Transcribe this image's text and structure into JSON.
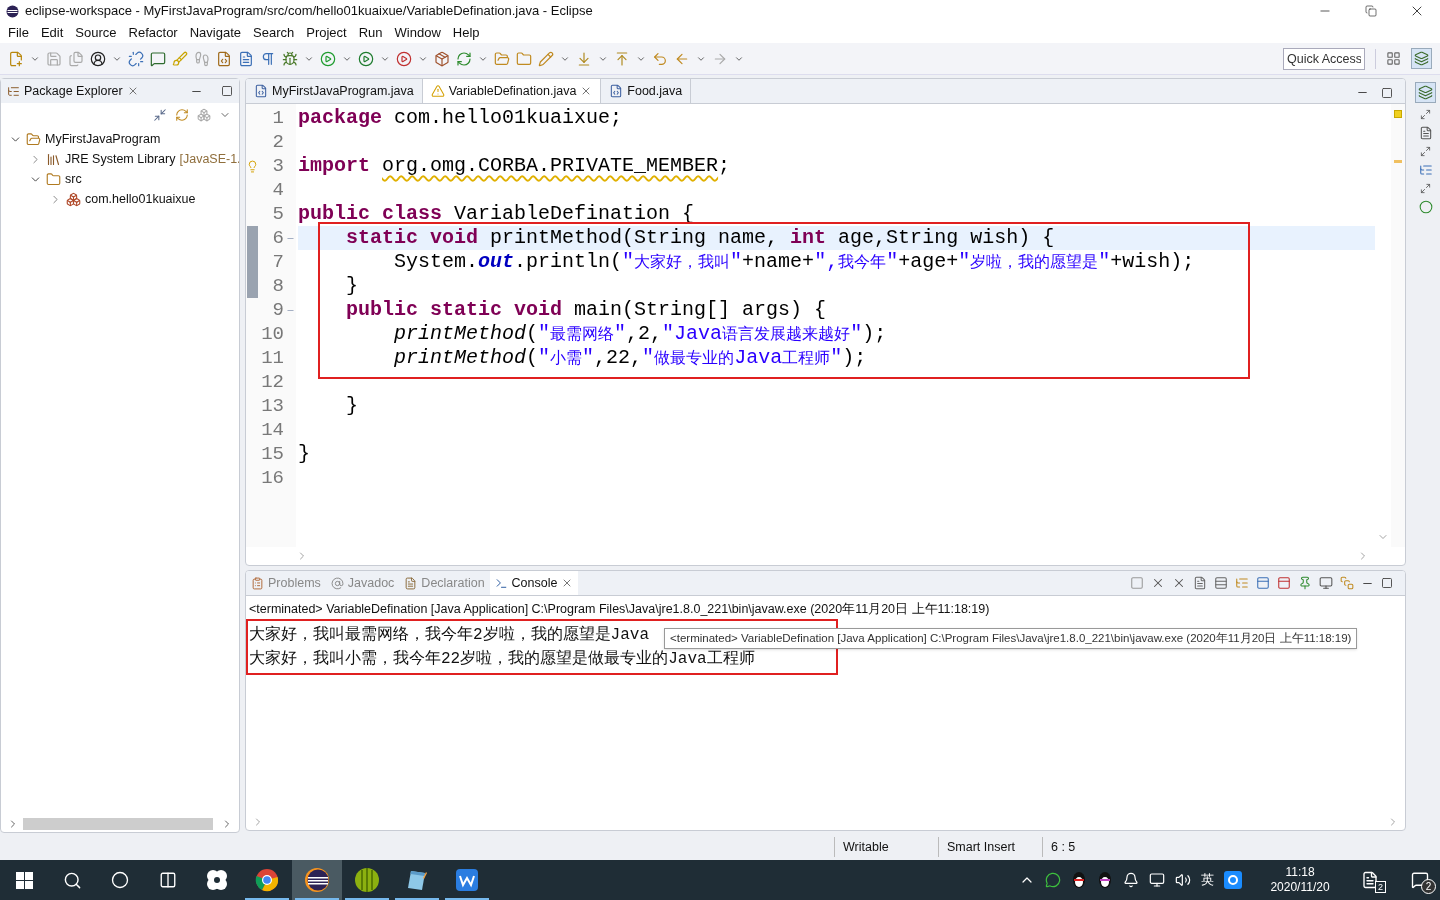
{
  "window": {
    "title": "eclipse-workspace - MyFirstJavaProgram/src/com/hello01kuaixue/VariableDefination.java - Eclipse"
  },
  "menu": [
    "File",
    "Edit",
    "Source",
    "Refactor",
    "Navigate",
    "Search",
    "Project",
    "Run",
    "Window",
    "Help"
  ],
  "toolbar": {
    "quick_access": {
      "placeholder": "Quick Access"
    }
  },
  "package_explorer": {
    "title": "Package Explorer",
    "tree": [
      {
        "label": "MyFirstJavaProgram",
        "kind": "project",
        "expanded": true,
        "children": [
          {
            "label": "JRE System Library",
            "suffix": "[JavaSE-1.",
            "kind": "library",
            "expanded": false
          },
          {
            "label": "src",
            "kind": "folder",
            "expanded": true,
            "children": [
              {
                "label": "com.hello01kuaixue",
                "kind": "package",
                "expanded": false
              }
            ]
          }
        ]
      }
    ]
  },
  "editor": {
    "tabs": [
      {
        "label": "MyFirstJavaProgram.java",
        "selected": false,
        "warning": false
      },
      {
        "label": "VariableDefination.java",
        "selected": true,
        "warning": true
      },
      {
        "label": "Food.java",
        "selected": false,
        "warning": false
      }
    ],
    "lines": [
      {
        "number": "1",
        "tokens": [
          {
            "kind": "keyword",
            "text": "package"
          },
          {
            "kind": "plain",
            "text": " com.hello01kuaixue;"
          }
        ]
      },
      {
        "number": "2"
      },
      {
        "number": "3",
        "warning": true,
        "tokens": [
          {
            "kind": "keyword",
            "text": "import "
          },
          {
            "kind": "warn",
            "text": "org.omg.CORBA.PRIVATE_MEMBER"
          },
          {
            "kind": "plain",
            "text": ";"
          }
        ]
      },
      {
        "number": "4"
      },
      {
        "number": "5",
        "tokens": [
          {
            "kind": "keyword",
            "text": "public class"
          },
          {
            "kind": "plain",
            "text": " VariableDefination {"
          }
        ]
      },
      {
        "number": "6",
        "fold": true,
        "current": true,
        "marked": true,
        "boxed": true,
        "tokens": [
          {
            "kind": "keyword",
            "text": "    static void"
          },
          {
            "kind": "plain",
            "text": " printMethod(String name, "
          },
          {
            "kind": "keyword",
            "text": "int"
          },
          {
            "kind": "plain",
            "text": " age,String wish) {"
          }
        ]
      },
      {
        "number": "7",
        "marked": true,
        "boxed": true,
        "tokens": [
          {
            "kind": "plain",
            "text": "        System."
          },
          {
            "kind": "field",
            "text": "out"
          },
          {
            "kind": "plain",
            "text": ".println("
          },
          {
            "kind": "string",
            "text": "\"大家好，我叫\""
          },
          {
            "kind": "plain",
            "text": "+name+"
          },
          {
            "kind": "string",
            "text": "\",我今年\""
          },
          {
            "kind": "plain",
            "text": "+age+"
          },
          {
            "kind": "string",
            "text": "\"岁啦，我的愿望是\""
          },
          {
            "kind": "plain",
            "text": "+wish);"
          }
        ]
      },
      {
        "number": "8",
        "marked": true,
        "boxed": true,
        "tokens": [
          {
            "kind": "plain",
            "text": "    }"
          }
        ]
      },
      {
        "number": "9",
        "fold": true,
        "boxed": true,
        "tokens": [
          {
            "kind": "keyword",
            "text": "    public static void"
          },
          {
            "kind": "plain",
            "text": " main(String[] args) {"
          }
        ]
      },
      {
        "number": "10",
        "boxed": true,
        "tokens": [
          {
            "kind": "call",
            "text": "        printMethod"
          },
          {
            "kind": "plain",
            "text": "("
          },
          {
            "kind": "string",
            "text": "\"最需网络\""
          },
          {
            "kind": "plain",
            "text": ",2,"
          },
          {
            "kind": "string",
            "text": "\"Java语言发展越来越好\""
          },
          {
            "kind": "plain",
            "text": ");"
          }
        ]
      },
      {
        "number": "11",
        "boxed": true,
        "tokens": [
          {
            "kind": "call",
            "text": "        printMethod"
          },
          {
            "kind": "plain",
            "text": "("
          },
          {
            "kind": "string",
            "text": "\"小需\""
          },
          {
            "kind": "plain",
            "text": ",22,"
          },
          {
            "kind": "string",
            "text": "\"做最专业的Java工程师\""
          },
          {
            "kind": "plain",
            "text": ");"
          }
        ]
      },
      {
        "number": "12"
      },
      {
        "number": "13",
        "tokens": [
          {
            "kind": "plain",
            "text": "    }"
          }
        ]
      },
      {
        "number": "14"
      },
      {
        "number": "15",
        "tokens": [
          {
            "kind": "plain",
            "text": "}"
          }
        ]
      },
      {
        "number": "16"
      }
    ]
  },
  "console": {
    "tabs": [
      {
        "label": "Problems",
        "selected": false
      },
      {
        "label": "Javadoc",
        "selected": false
      },
      {
        "label": "Declaration",
        "selected": false
      },
      {
        "label": "Console",
        "selected": true
      }
    ],
    "header": "<terminated> VariableDefination [Java Application] C:\\Program Files\\Java\\jre1.8.0_221\\bin\\javaw.exe (2020年11月20日 上午11:18:19)",
    "boxed": true,
    "output": [
      "大家好，我叫最需网络，我今年2岁啦，我的愿望是Java",
      "大家好，我叫小需，我今年22岁啦，我的愿望是做最专业的Java工程师"
    ],
    "tooltip": "<terminated> VariableDefination [Java Application] C:\\Program Files\\Java\\jre1.8.0_221\\bin\\javaw.exe (2020年11月20日 上午11:18:19)"
  },
  "status_bar": [
    "Writable",
    "Smart Insert",
    "6 : 5"
  ],
  "taskbar": {
    "apps": [
      {
        "kind": "pinwheel",
        "running": false,
        "selected": false
      },
      {
        "kind": "chrome",
        "running": true,
        "selected": false
      },
      {
        "kind": "eclipse",
        "running": true,
        "selected": true
      },
      {
        "kind": "bamboo",
        "running": true,
        "selected": false
      },
      {
        "kind": "notepad",
        "running": true,
        "selected": false
      },
      {
        "kind": "wps",
        "running": true,
        "selected": false
      }
    ],
    "ime": "英",
    "time": "11:18",
    "date": "2020/11/20",
    "task_badge": "2",
    "notification_badge": "2"
  }
}
